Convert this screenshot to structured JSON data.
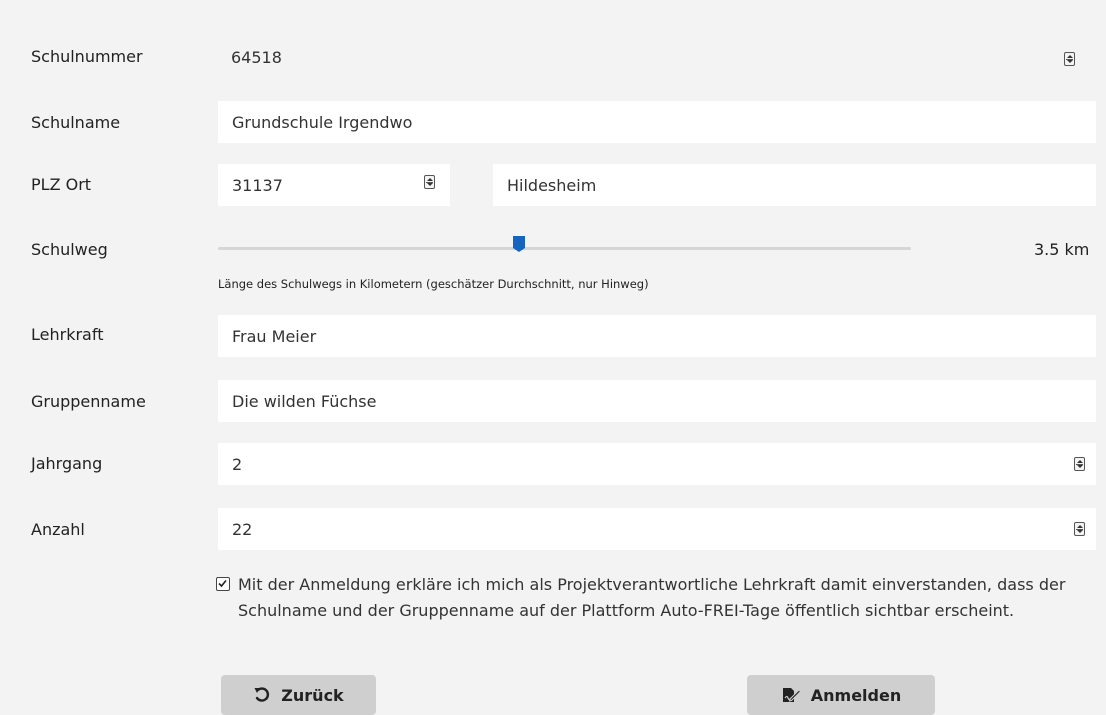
{
  "form": {
    "schulnummer": {
      "label": "Schulnummer",
      "value": "64518"
    },
    "schulname": {
      "label": "Schulname",
      "value": "Grundschule Irgendwo"
    },
    "plz_ort": {
      "label": "PLZ Ort",
      "plz": "31137",
      "ort": "Hildesheim"
    },
    "schulweg": {
      "label": "Schulweg",
      "value_text": "3.5 km",
      "value": 3.5,
      "helper": "Länge des Schulwegs in Kilometern (geschätzer Durchschnitt, nur Hinweg)"
    },
    "lehrkraft": {
      "label": "Lehrkraft",
      "value": "Frau Meier"
    },
    "gruppenname": {
      "label": "Gruppenname",
      "value": "Die wilden Füchse"
    },
    "jahrgang": {
      "label": "Jahrgang",
      "value": "2"
    },
    "anzahl": {
      "label": "Anzahl",
      "value": "22"
    },
    "consent": {
      "checked": true,
      "text": "Mit der Anmeldung erkläre ich mich als Projektverantwortliche Lehrkraft damit einverstanden, dass der Schulname und der Gruppenname auf der Plattform Auto-FREI-Tage öffentlich sichtbar erscheint."
    }
  },
  "buttons": {
    "back": {
      "label": "Zurück",
      "icon": "undo-icon"
    },
    "submit": {
      "label": "Anmelden",
      "icon": "signature-icon"
    }
  },
  "colors": {
    "accent": "#1565c0",
    "field_bg": "#ffffff",
    "page_bg": "#f3f3f3",
    "button_bg": "#cfcfcf"
  }
}
